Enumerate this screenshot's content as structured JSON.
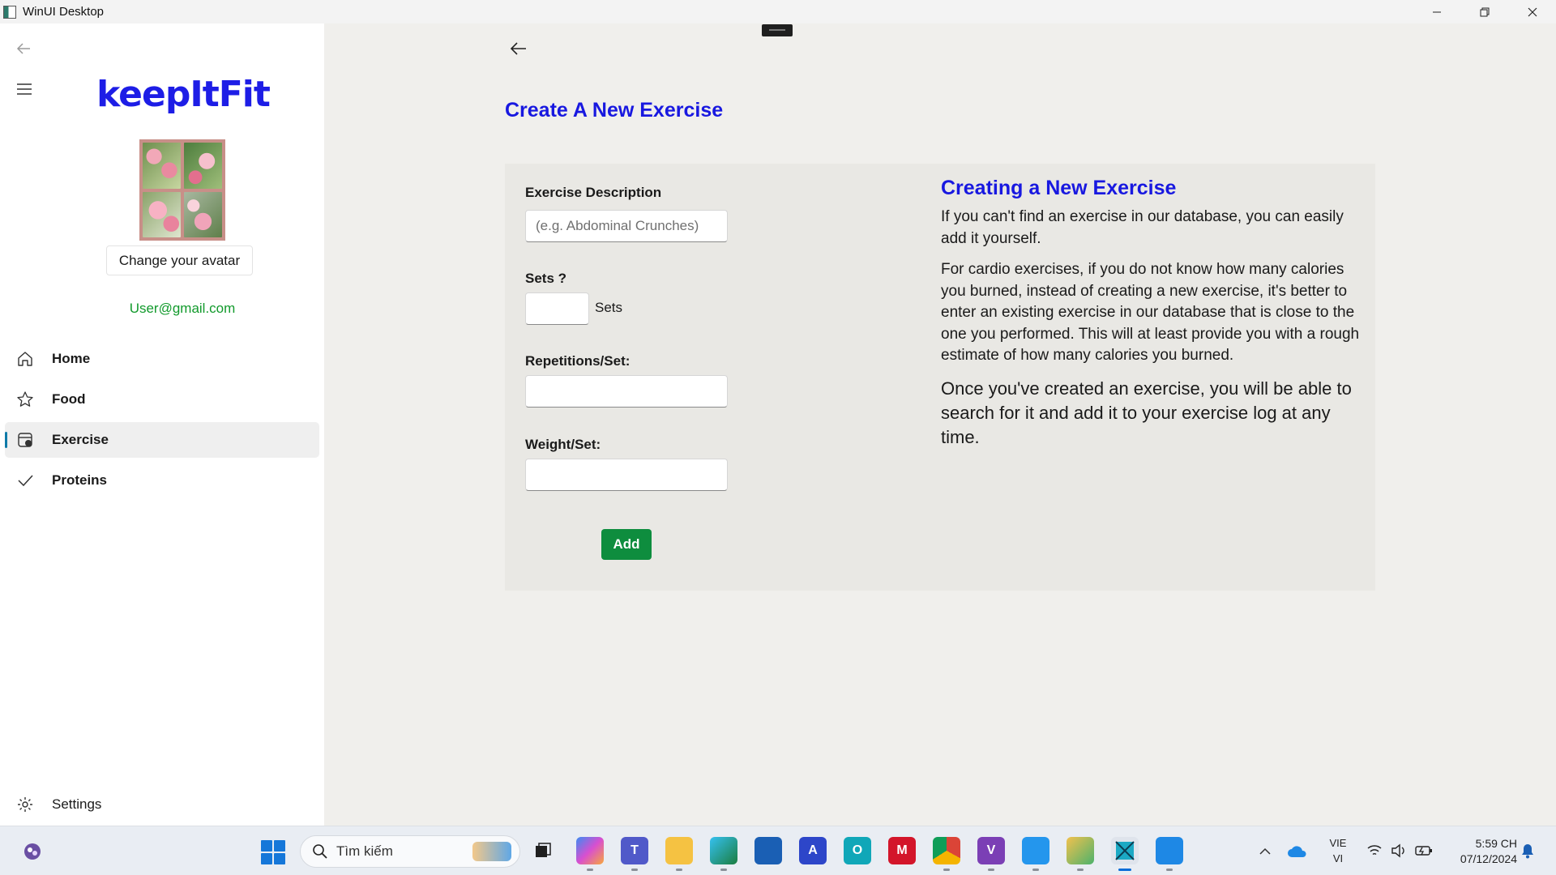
{
  "window": {
    "title": "WinUI Desktop"
  },
  "sidebar": {
    "logo": "keepItFit",
    "avatar_button": "Change your avatar",
    "email": "User@gmail.com",
    "nav": [
      {
        "label": "Home",
        "icon": "home-icon",
        "active": false
      },
      {
        "label": "Food",
        "icon": "star-icon",
        "active": false
      },
      {
        "label": "Exercise",
        "icon": "exercise-icon",
        "active": true
      },
      {
        "label": "Proteins",
        "icon": "check-icon",
        "active": false
      }
    ],
    "settings_label": "Settings"
  },
  "main": {
    "title": "Create A New Exercise",
    "form": {
      "description_label": "Exercise Description",
      "description_placeholder": "(e.g. Abdominal Crunches)",
      "description_value": "",
      "sets_label": "Sets ?",
      "sets_value": "",
      "sets_suffix": "Sets",
      "reps_label": "Repetitions/Set:",
      "reps_value": "",
      "weight_label": "Weight/Set:",
      "weight_value": "",
      "add_label": "Add"
    },
    "help": {
      "title": "Creating a New Exercise",
      "p1": "If you can't find an exercise in our database, you can easily add it yourself.",
      "p2": "For cardio exercises, if you do not know how many calories you burned, instead of creating a new exercise, it's better to enter an existing exercise in our database that is close to the one you performed. This will at least provide you with a rough estimate of how many calories you burned.",
      "p3": "Once you've created an exercise, you will be able to search for it and add it to your exercise log at any time."
    }
  },
  "taskbar": {
    "search_placeholder": "Tìm kiếm",
    "lang_line1": "VIE",
    "lang_line2": "VI",
    "time": "5:59 CH",
    "date": "07/12/2024"
  },
  "colors": {
    "accent_blue": "#1818e0",
    "green": "#0e8d3e",
    "email_green": "#129a2c"
  }
}
